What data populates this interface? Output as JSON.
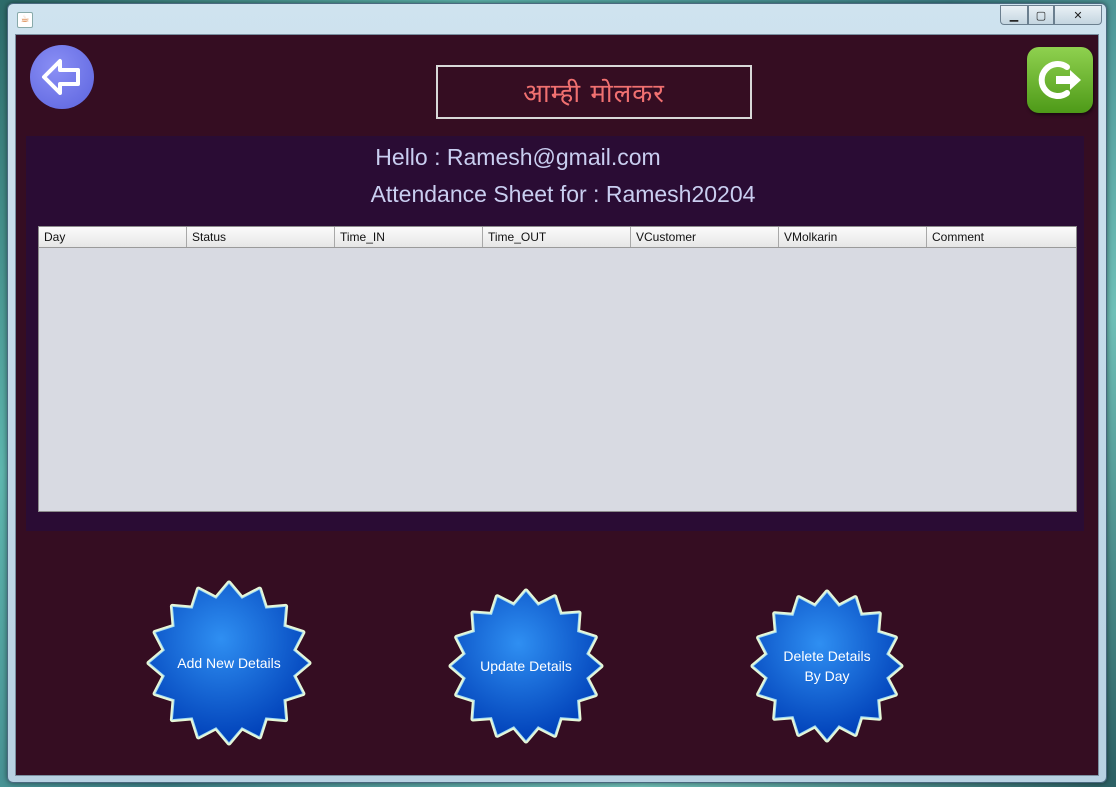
{
  "window": {
    "icon": "java-icon",
    "controls": {
      "minimize": "minimize-icon",
      "maximize": "maximize-icon",
      "close": "close-icon"
    }
  },
  "header": {
    "title": "आम्ही मोलकर",
    "back_icon": "arrow-left-icon",
    "exit_icon": "logout-icon"
  },
  "greeting": "Hello : Ramesh@gmail.com",
  "sheet_title": "Attendance Sheet for : Ramesh20204",
  "table": {
    "columns": [
      "Day",
      "Status",
      "Time_IN",
      "Time_OUT",
      "VCustomer",
      "VMolkarin",
      "Comment"
    ],
    "rows": []
  },
  "actions": {
    "add": "Add New Details",
    "update": "Update Details",
    "delete_line1": "Delete Details",
    "delete_line2": "By Day"
  },
  "colors": {
    "background": "#350d22",
    "panel": "#2a0c34",
    "title_text": "#f07070",
    "greeting_text": "#c9cef0",
    "star_button": "#0a5fd0",
    "exit_button": "#5fae22",
    "back_button": "#6a72e8"
  }
}
